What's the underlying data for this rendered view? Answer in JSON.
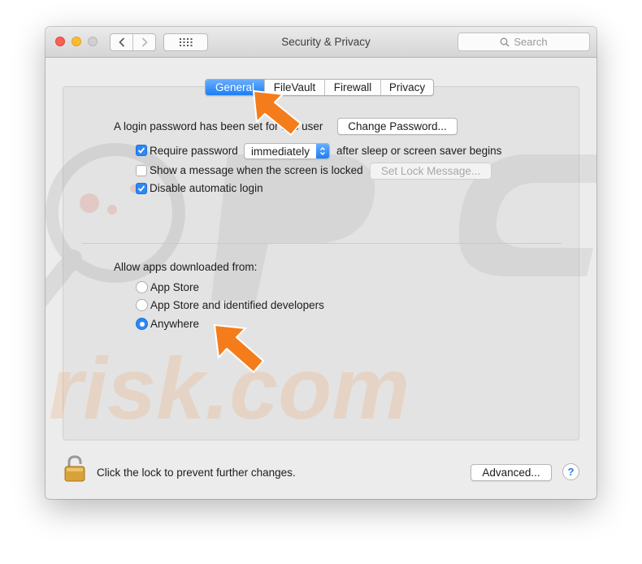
{
  "window": {
    "title": "Security & Privacy",
    "search_placeholder": "Search"
  },
  "tabs": [
    {
      "label": "General",
      "active": true
    },
    {
      "label": "FileVault",
      "active": false
    },
    {
      "label": "Firewall",
      "active": false
    },
    {
      "label": "Privacy",
      "active": false
    }
  ],
  "general": {
    "login_text": "A login password has been set for this user",
    "change_password_label": "Change Password...",
    "require_password": {
      "label": "Require password",
      "checked": true
    },
    "require_password_delay": "immediately",
    "after_sleep_text": "after sleep or screen saver begins",
    "show_message": {
      "label": "Show a message when the screen is locked",
      "checked": false
    },
    "set_lock_message_label": "Set Lock Message...",
    "disable_auto_login": {
      "label": "Disable automatic login",
      "checked": true
    }
  },
  "allow_apps": {
    "heading": "Allow apps downloaded from:",
    "options": [
      {
        "label": "App Store",
        "selected": false
      },
      {
        "label": "App Store and identified developers",
        "selected": false
      },
      {
        "label": "Anywhere",
        "selected": true
      }
    ]
  },
  "footer": {
    "lock_text": "Click the lock to prevent further changes.",
    "advanced_label": "Advanced...",
    "help_label": "?"
  },
  "watermark": {
    "logo_text": "PC",
    "site_text": "risk.com"
  },
  "colors": {
    "accent": "#2a88f7",
    "arrow": "#f57c1a"
  }
}
